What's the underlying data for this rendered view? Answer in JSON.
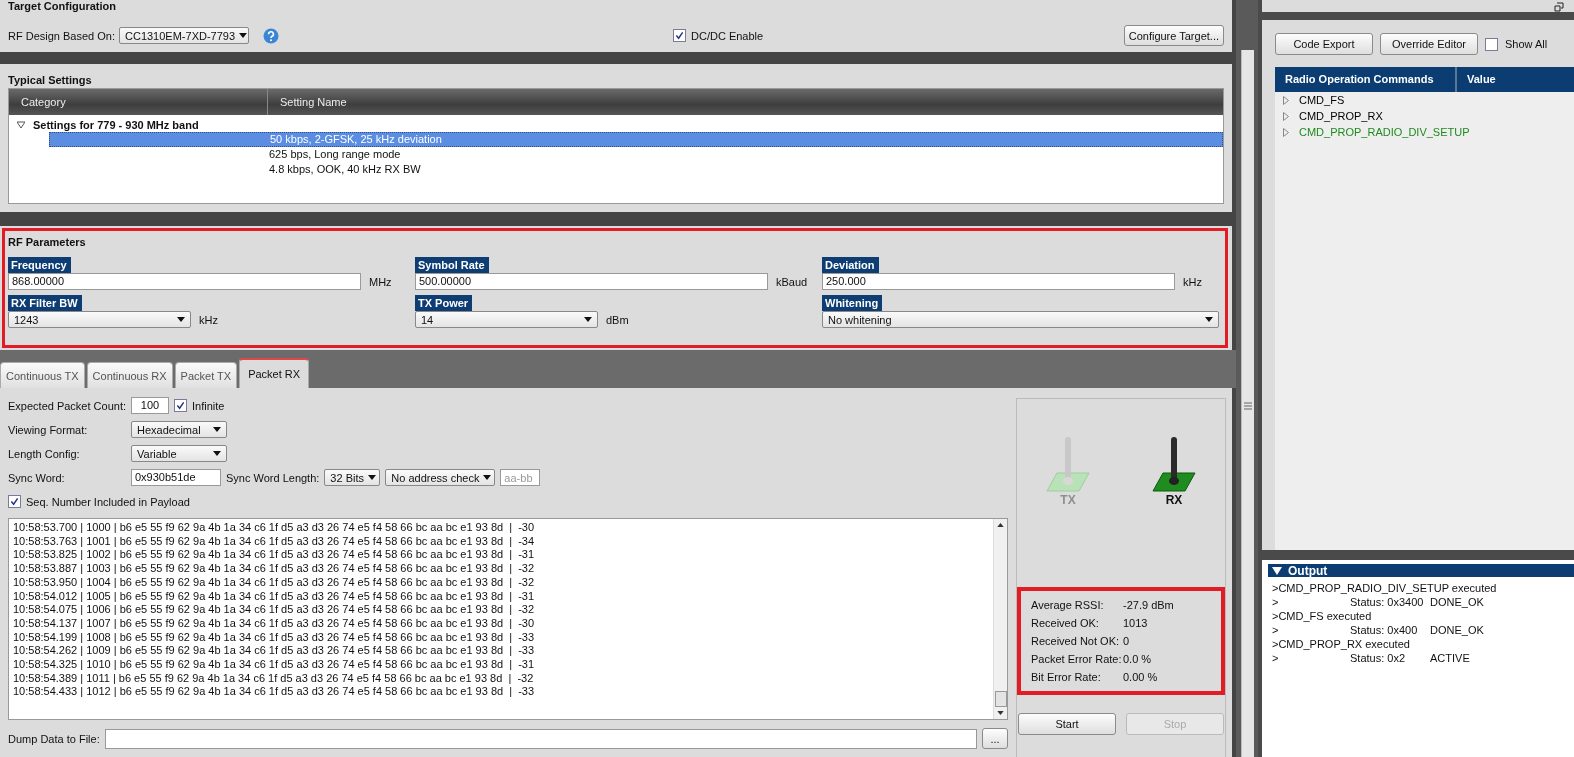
{
  "target_configuration": {
    "title": "Target Configuration",
    "rf_design_label": "RF Design Based On:",
    "rf_design_value": "CC1310EM-7XD-7793",
    "dcdc": {
      "label": "DC/DC Enable",
      "checked": true
    },
    "configure_button": "Configure Target..."
  },
  "typical_settings": {
    "title": "Typical Settings",
    "columns": [
      "Category",
      "Setting Name"
    ],
    "groups": [
      {
        "label": "Settings for 779 - 930 MHz band",
        "expanded": true,
        "children": [
          {
            "label": "50 kbps, 2-GFSK, 25 kHz deviation",
            "selected": true
          },
          {
            "label": "625 bps, Long range mode",
            "selected": false
          },
          {
            "label": "4.8 kbps, OOK, 40 kHz RX BW",
            "selected": false
          }
        ]
      }
    ]
  },
  "rf_parameters": {
    "title": "RF Parameters",
    "fields": [
      {
        "kind": "input",
        "label": "Frequency",
        "value": "868.00000",
        "unit": "MHz"
      },
      {
        "kind": "input",
        "label": "Symbol Rate",
        "value": "500.00000",
        "unit": "kBaud"
      },
      {
        "kind": "input",
        "label": "Deviation",
        "value": "250.000",
        "unit": "kHz"
      },
      {
        "kind": "select",
        "label": "RX Filter BW",
        "value": "1243",
        "unit": "kHz"
      },
      {
        "kind": "select",
        "label": "TX Power",
        "value": "14",
        "unit": "dBm"
      },
      {
        "kind": "select",
        "label": "Whitening",
        "value": "No whitening"
      }
    ]
  },
  "tabs": [
    {
      "label": "Continuous TX",
      "selected": false
    },
    {
      "label": "Continuous RX",
      "selected": false
    },
    {
      "label": "Packet TX",
      "selected": false
    },
    {
      "label": "Packet RX",
      "selected": true
    }
  ],
  "packet_rx": {
    "expected_count": {
      "label": "Expected Packet Count:",
      "value": "100"
    },
    "infinite": {
      "label": "Infinite",
      "checked": true
    },
    "viewing_format": {
      "label": "Viewing Format:",
      "value": "Hexadecimal"
    },
    "length_config": {
      "label": "Length Config:",
      "value": "Variable"
    },
    "sync_word": {
      "label": "Sync Word:",
      "value": "0x930b51de"
    },
    "sync_word_length": {
      "label": "Sync Word Length:",
      "value": "32 Bits"
    },
    "address_check": {
      "value": "No address check"
    },
    "address_field": {
      "placeholder": "aa-bb"
    },
    "seq_number": {
      "label": "Seq. Number Included in Payload",
      "checked": true
    },
    "log": [
      "10:58:53.700 | 1000 | b6 e5 55 f9 62 9a 4b 1a 34 c6 1f d5 a3 d3 26 74 e5 f4 58 66 bc aa bc e1 93 8d  |  -30",
      "10:58:53.763 | 1001 | b6 e5 55 f9 62 9a 4b 1a 34 c6 1f d5 a3 d3 26 74 e5 f4 58 66 bc aa bc e1 93 8d  |  -34",
      "10:58:53.825 | 1002 | b6 e5 55 f9 62 9a 4b 1a 34 c6 1f d5 a3 d3 26 74 e5 f4 58 66 bc aa bc e1 93 8d  |  -31",
      "10:58:53.887 | 1003 | b6 e5 55 f9 62 9a 4b 1a 34 c6 1f d5 a3 d3 26 74 e5 f4 58 66 bc aa bc e1 93 8d  |  -32",
      "10:58:53.950 | 1004 | b6 e5 55 f9 62 9a 4b 1a 34 c6 1f d5 a3 d3 26 74 e5 f4 58 66 bc aa bc e1 93 8d  |  -32",
      "10:58:54.012 | 1005 | b6 e5 55 f9 62 9a 4b 1a 34 c6 1f d5 a3 d3 26 74 e5 f4 58 66 bc aa bc e1 93 8d  |  -31",
      "10:58:54.075 | 1006 | b6 e5 55 f9 62 9a 4b 1a 34 c6 1f d5 a3 d3 26 74 e5 f4 58 66 bc aa bc e1 93 8d  |  -32",
      "10:58:54.137 | 1007 | b6 e5 55 f9 62 9a 4b 1a 34 c6 1f d5 a3 d3 26 74 e5 f4 58 66 bc aa bc e1 93 8d  |  -30",
      "10:58:54.199 | 1008 | b6 e5 55 f9 62 9a 4b 1a 34 c6 1f d5 a3 d3 26 74 e5 f4 58 66 bc aa bc e1 93 8d  |  -33",
      "10:58:54.262 | 1009 | b6 e5 55 f9 62 9a 4b 1a 34 c6 1f d5 a3 d3 26 74 e5 f4 58 66 bc aa bc e1 93 8d  |  -33",
      "10:58:54.325 | 1010 | b6 e5 55 f9 62 9a 4b 1a 34 c6 1f d5 a3 d3 26 74 e5 f4 58 66 bc aa bc e1 93 8d  |  -31",
      "10:58:54.389 | 1011 | b6 e5 55 f9 62 9a 4b 1a 34 c6 1f d5 a3 d3 26 74 e5 f4 58 66 bc aa bc e1 93 8d  |  -32",
      "10:58:54.433 | 1012 | b6 e5 55 f9 62 9a 4b 1a 34 c6 1f d5 a3 d3 26 74 e5 f4 58 66 bc aa bc e1 93 8d  |  -33"
    ],
    "dump": {
      "label": "Dump Data to File:",
      "button": "..."
    }
  },
  "indicators": [
    {
      "label": "TX",
      "active": false
    },
    {
      "label": "RX",
      "active": true
    }
  ],
  "statistics": [
    {
      "label": "Average RSSI:",
      "value": "-27.9 dBm"
    },
    {
      "label": "Received OK:",
      "value": "1013"
    },
    {
      "label": "Received Not OK:",
      "value": "0"
    },
    {
      "label": "Packet Error Rate:",
      "value": "0.0 %"
    },
    {
      "label": "Bit Error Rate:",
      "value": "0.00 %"
    }
  ],
  "buttons": [
    {
      "label": "Start",
      "disabled": false
    },
    {
      "label": "Stop",
      "disabled": true
    }
  ],
  "right_panel": {
    "buttons": [
      "Code Export",
      "Override Editor"
    ],
    "show_all": {
      "label": "Show All",
      "checked": false
    },
    "columns": [
      "Radio Operation Commands",
      "Value"
    ],
    "commands": [
      {
        "label": "CMD_FS",
        "color": "#000000"
      },
      {
        "label": "CMD_PROP_RX",
        "color": "#000000"
      },
      {
        "label": "CMD_PROP_RADIO_DIV_SETUP",
        "color": "#1e8a1e"
      }
    ]
  },
  "output": {
    "title": "Output",
    "expanded": true,
    "lines": [
      {
        "kind": "command",
        "text": ">CMD_PROP_RADIO_DIV_SETUP executed"
      },
      {
        "kind": "status",
        "prefix": ">",
        "status": "Status: 0x3400",
        "result": "DONE_OK"
      },
      {
        "kind": "command",
        "text": ">CMD_FS executed"
      },
      {
        "kind": "status",
        "prefix": ">",
        "status": "Status: 0x400",
        "result": "DONE_OK"
      },
      {
        "kind": "command",
        "text": ">CMD_PROP_RX executed"
      },
      {
        "kind": "status",
        "prefix": ">",
        "status": "Status: 0x2",
        "result": "ACTIVE"
      }
    ]
  }
}
